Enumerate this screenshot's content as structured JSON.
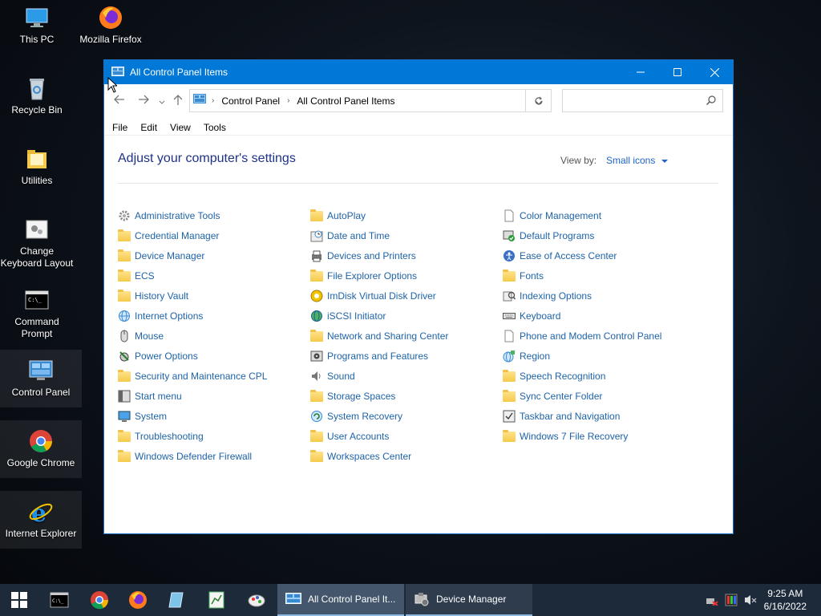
{
  "desktop": {
    "icons": [
      {
        "label": "This PC"
      },
      {
        "label": "Mozilla Firefox"
      },
      {
        "label": "Recycle Bin"
      },
      {
        "label": "Utilities"
      },
      {
        "label": "Change Keyboard Layout"
      },
      {
        "label": "Command Prompt"
      },
      {
        "label": "Control Panel"
      },
      {
        "label": "Google Chrome"
      },
      {
        "label": "Internet Explorer"
      }
    ]
  },
  "window": {
    "title": "All Control Panel Items",
    "breadcrumb": [
      "Control Panel",
      "All Control Panel Items"
    ],
    "search_placeholder": "",
    "menu": [
      "File",
      "Edit",
      "View",
      "Tools"
    ],
    "heading": "Adjust your computer's settings",
    "view_by_label": "View by:",
    "view_by_value": "Small icons",
    "columns": [
      [
        "Administrative Tools",
        "Credential Manager",
        "Device Manager",
        "ECS",
        "History Vault",
        "Internet Options",
        "Mouse",
        "Power Options",
        "Security and Maintenance CPL",
        "Start menu",
        "System",
        "Troubleshooting",
        "Windows Defender Firewall"
      ],
      [
        "AutoPlay",
        "Date and Time",
        "Devices and Printers",
        "File Explorer Options",
        "ImDisk Virtual Disk Driver",
        "iSCSI Initiator",
        "Network and Sharing Center",
        "Programs and Features",
        "Sound",
        "Storage Spaces",
        "System Recovery",
        "User Accounts",
        "Workspaces Center"
      ],
      [
        "Color Management",
        "Default Programs",
        "Ease of Access Center",
        "Fonts",
        "Indexing Options",
        "Keyboard",
        "Phone and Modem Control Panel",
        "Region",
        "Speech Recognition",
        "Sync Center Folder",
        "Taskbar and Navigation",
        "Windows 7 File Recovery"
      ]
    ]
  },
  "taskbar": {
    "tasks": [
      {
        "label": "All Control Panel It..."
      },
      {
        "label": "Device Manager"
      }
    ],
    "time": "9:25 AM",
    "date": "6/16/2022"
  },
  "colors": {
    "titlebar": "#0078d7",
    "link": "#1e63a8",
    "heading": "#1e3287",
    "taskbar": "#1d2a3a"
  }
}
